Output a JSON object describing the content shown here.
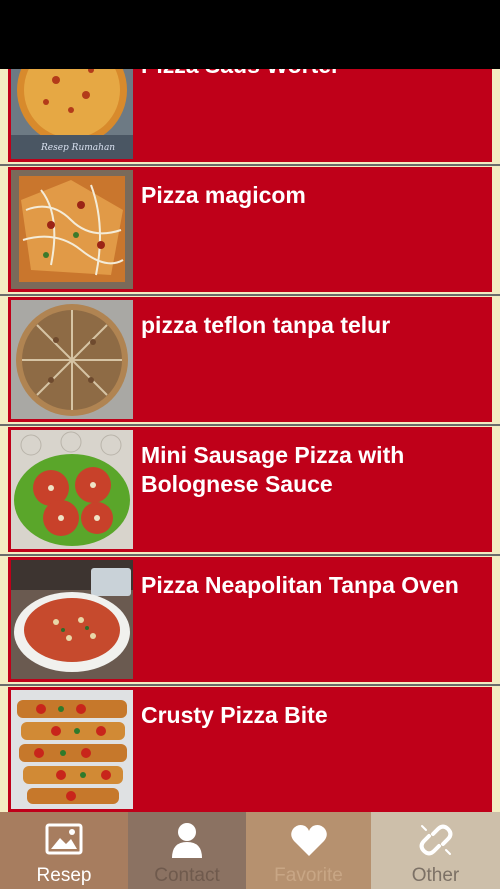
{
  "recipes": [
    {
      "title": "Pizza Saus Worter",
      "thumb": "pizza-photo-round",
      "watermark": "Resep Rumahan"
    },
    {
      "title": "Pizza magicom",
      "thumb": "pizza-photo-toppings"
    },
    {
      "title": "pizza teflon tanpa telur",
      "thumb": "pizza-photo-slices"
    },
    {
      "title": "Mini Sausage Pizza with Bolognese Sauce",
      "thumb": "pizza-photo-mini"
    },
    {
      "title": "Pizza Neapolitan Tanpa Oven",
      "thumb": "pizza-photo-plate"
    },
    {
      "title": "Crusty Pizza Bite",
      "thumb": "pizza-photo-bites"
    }
  ],
  "tabs": [
    {
      "label": "Resep",
      "icon": "image-icon",
      "bg": "#a77d5f",
      "fg": "#ffffff",
      "active": true
    },
    {
      "label": "Contact",
      "icon": "person-icon",
      "bg": "#8b7262",
      "fg": "#6f5a4d",
      "active": false
    },
    {
      "label": "Favorite",
      "icon": "heart-icon",
      "bg": "#b6916f",
      "fg": "#c8a685",
      "active": false
    },
    {
      "label": "Other",
      "icon": "link-icon",
      "bg": "#cdbfaa",
      "fg": "#7c7166",
      "active": false
    }
  ],
  "colors": {
    "row_bg": "#bf0019",
    "page_bg": "#f3ecc2",
    "status_bar": "#000000"
  }
}
